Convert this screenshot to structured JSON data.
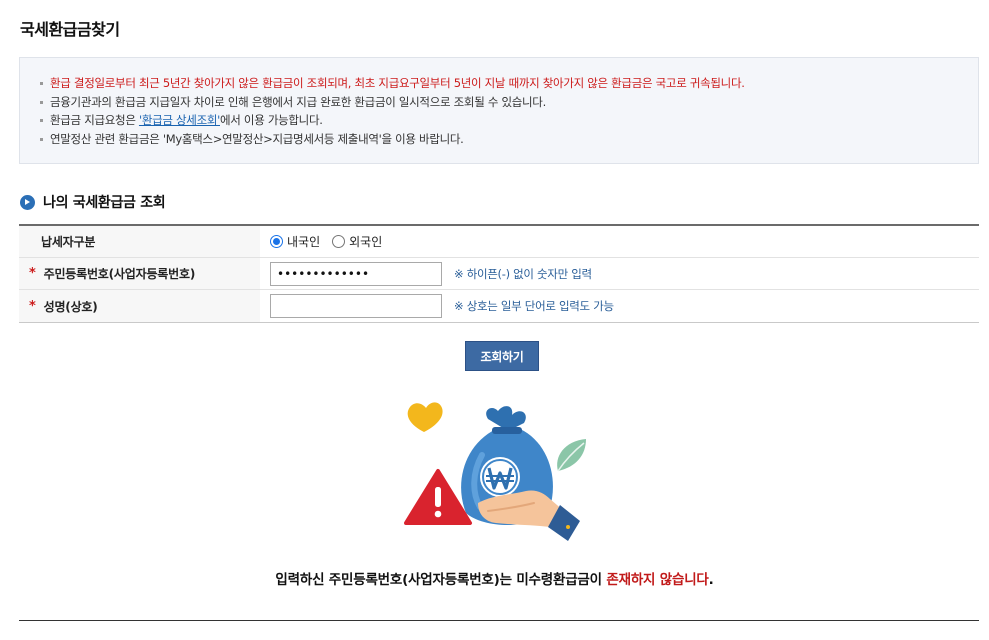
{
  "page": {
    "title": "국세환급금찾기"
  },
  "notice": {
    "items": [
      "환급 결정일로부터 최근 5년간 찾아가지 않은 환급금이 조회되며, 최초 지급요구일부터 5년이 지날 때까지 찾아가지 않은 환급금은 국고로 귀속됩니다.",
      "금융기관과의 환급금 지급일자 차이로 인해 은행에서 지급 완료한 환급금이 일시적으로 조회될 수 있습니다.",
      "연말정산 관련 환급금은 'My홈택스>연말정산>지급명세서등 제출내역'을 이용 바랍니다."
    ],
    "item3_prefix": "환급금 지급요청은 ",
    "item3_link": "'환급금 상세조회'",
    "item3_suffix": "에서 이용 가능합니다."
  },
  "section": {
    "title": "나의 국세환급금 조회"
  },
  "form": {
    "taxpayer_type_label": "납세자구분",
    "options": [
      "내국인",
      "외국인"
    ],
    "selected_option": "내국인",
    "required_mark": "*",
    "id_label": "주민등록번호(사업자등록번호)",
    "id_value": "•••••••••••••",
    "id_hint": "※ 하이픈(-) 없이 숫자만 입력",
    "name_label": "성명(상호)",
    "name_value": "",
    "name_hint": "※ 상호는 일부 단어로 입력도 가능"
  },
  "search_button": {
    "label": "조회하기"
  },
  "result": {
    "prefix": "입력하신 주민등록번호(사업자등록번호)는 미수령환급금이 ",
    "highlight": "존재하지 않습니다",
    "suffix": "."
  },
  "colors": {
    "accent": "#3d6aa3",
    "warning_red": "#cc1b1b",
    "hint_blue": "#2b5f99"
  },
  "icons": {
    "section": "arrow-circle-icon",
    "illustration": "money-bag-warning-illustration"
  }
}
